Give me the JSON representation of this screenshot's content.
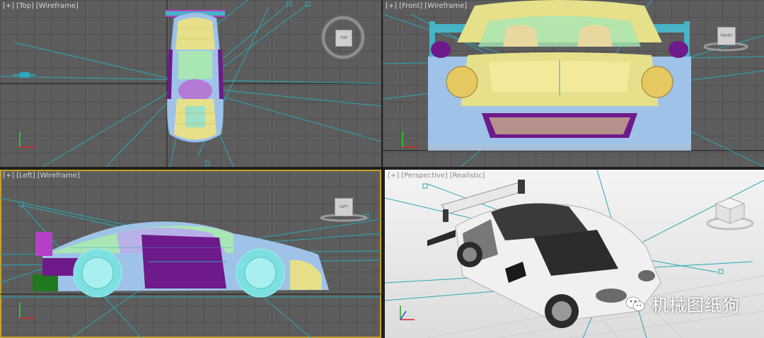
{
  "viewports": [
    {
      "id": "top",
      "label_menu": "[+]",
      "label_view": "[Top]",
      "label_shading": "[Wireframe]",
      "cube_text": "TOP"
    },
    {
      "id": "front",
      "label_menu": "[+]",
      "label_view": "[Front]",
      "label_shading": "[Wireframe]",
      "cube_text": "FRONT"
    },
    {
      "id": "left",
      "label_menu": "[+]",
      "label_view": "[Left]",
      "label_shading": "[Wireframe]",
      "cube_text": "LEFT"
    },
    {
      "id": "perspective",
      "label_menu": "[+]",
      "label_view": "[Perspective]",
      "label_shading": "[Realistic]"
    }
  ],
  "watermark": {
    "text": "机械图纸狗",
    "icon": "wechat-icon"
  },
  "colors": {
    "wire_bg": "#5d5d5d",
    "grid": "#4f4f4f",
    "active_border": "#c9a227",
    "car_yellow": "#e6e08a",
    "car_blue": "#9fc3e8",
    "car_purple": "#6e1a8a",
    "car_cyan": "#7de0e0",
    "light_line": "#2aa7b8",
    "realistic_bg": "#ececec"
  }
}
